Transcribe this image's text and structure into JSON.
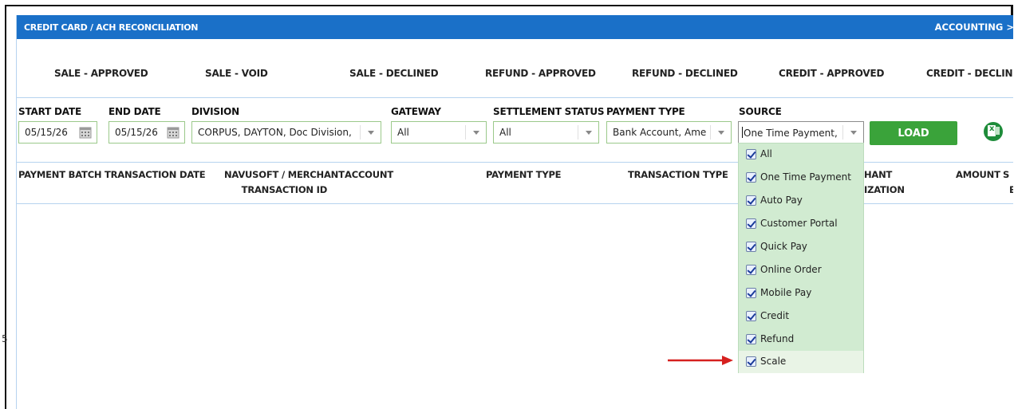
{
  "title_bar": {
    "title": "CREDIT CARD / ACH RECONCILIATION",
    "breadcrumb": "ACCOUNTING >"
  },
  "status_tabs": [
    "SALE - APPROVED",
    "SALE - VOID",
    "SALE - DECLINED",
    "REFUND - APPROVED",
    "REFUND - DECLINED",
    "CREDIT - APPROVED",
    "CREDIT - DECLINED"
  ],
  "filters": {
    "start_date": {
      "label": "START DATE",
      "value": "05/15/26"
    },
    "end_date": {
      "label": "END DATE",
      "value": "05/15/26"
    },
    "division": {
      "label": "DIVISION",
      "value": "CORPUS, DAYTON, Doc Division,"
    },
    "gateway": {
      "label": "GATEWAY",
      "value": "All"
    },
    "settlement_status": {
      "label": "SETTLEMENT STATUS",
      "value": "All"
    },
    "payment_type": {
      "label": "PAYMENT TYPE",
      "value": "Bank Account, Ame"
    },
    "source": {
      "label": "SOURCE",
      "value": "One Time Payment,"
    },
    "load_label": "LOAD"
  },
  "table_headers": {
    "payment_batch": "PAYMENT BATCH",
    "transaction_date": "TRANSACTION DATE",
    "navusoft_line1": "NAVUSOFT / MERCHANT",
    "navusoft_line2": "TRANSACTION ID",
    "account": "ACCOUNT",
    "payment_type": "PAYMENT TYPE",
    "transaction_type": "TRANSACTION TYPE",
    "merchant_line1": "HANT",
    "merchant_line2": "IZATION",
    "amount": "AMOUNT",
    "extra_line1": "S",
    "extra_line2": "B"
  },
  "source_options": [
    {
      "label": "All",
      "checked": true
    },
    {
      "label": "One Time Payment",
      "checked": true
    },
    {
      "label": "Auto Pay",
      "checked": true
    },
    {
      "label": "Customer Portal",
      "checked": true
    },
    {
      "label": "Quick Pay",
      "checked": true
    },
    {
      "label": "Online Order",
      "checked": true
    },
    {
      "label": "Mobile Pay",
      "checked": true
    },
    {
      "label": "Credit",
      "checked": true
    },
    {
      "label": "Refund",
      "checked": true
    },
    {
      "label": "Scale",
      "checked": true
    }
  ],
  "colors": {
    "header_blue": "#1a70c8",
    "load_green": "#3aa33a",
    "dropdown_bg": "#d1ebd1",
    "arrow_red": "#d6201f"
  },
  "icons": [
    "calendar-icon",
    "chevron-down-icon",
    "excel-export-icon",
    "checkbox-checked-icon",
    "annotation-arrow-icon"
  ]
}
